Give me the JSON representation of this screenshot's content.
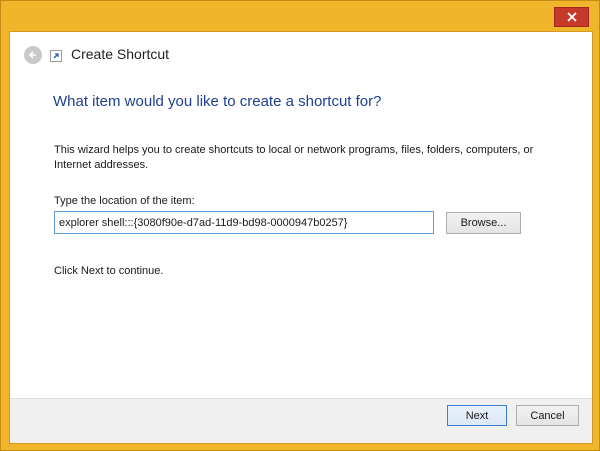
{
  "window": {
    "title": "Create Shortcut",
    "close_icon": "close-icon",
    "back_icon": "back-arrow-icon",
    "app_icon": "shortcut-icon",
    "frame_color": "#f0b52a",
    "close_color": "#c7392b"
  },
  "content": {
    "heading": "What item would you like to create a shortcut for?",
    "description": "This wizard helps you to create shortcuts to local or network programs, files, folders, computers, or Internet addresses.",
    "location_label": "Type the location of the item:",
    "location_value": "explorer shell:::{3080f90e-d7ad-11d9-bd98-0000947b0257}",
    "browse_label": "Browse...",
    "hint": "Click Next to continue."
  },
  "footer": {
    "next_label": "Next",
    "cancel_label": "Cancel"
  }
}
